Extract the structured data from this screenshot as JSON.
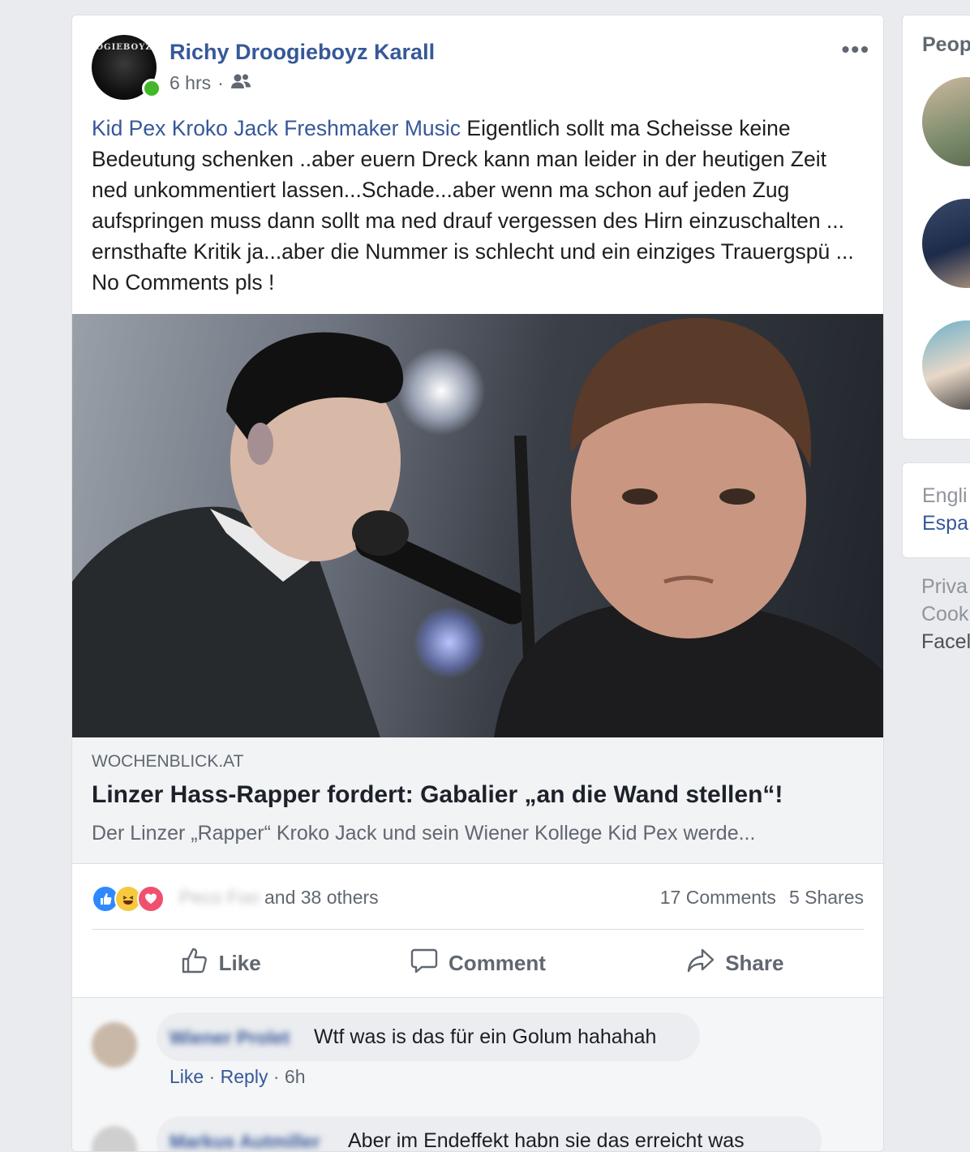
{
  "post": {
    "author": "Richy Droogieboyz Karall",
    "avatar_logo": "OGIEBOYZ",
    "time": "6 hrs",
    "separator": "·",
    "audience_icon": "friends-icon",
    "more_label": "•••",
    "mention": "Kid Pex Kroko Jack Freshmaker Music",
    "text": " Eigentlich sollt ma Scheisse keine Bedeutung schenken ..aber euern Dreck kann man leider in der heutigen Zeit ned unkommentiert lassen...Schade...aber wenn ma schon auf jeden Zug aufspringen muss dann sollt ma ned drauf vergessen des Hirn einzuschalten ... ernsthafte Kritik ja...aber die Nummer is schlecht und ein einziges Trauergspü ... No Comments pls !"
  },
  "link": {
    "domain": "WOCHENBLICK.AT",
    "title": "Linzer Hass-Rapper fordert: Gabalier „an die Wand stellen“!",
    "description": "Der Linzer „Rapper“ Kroko Jack und sein Wiener Kollege Kid Pex werde..."
  },
  "stats": {
    "reactions": [
      "like-icon",
      "haha-icon",
      "love-icon"
    ],
    "reactor_name": "Peco Foo",
    "others": "and 38 others",
    "comments": "17 Comments",
    "shares": "5 Shares"
  },
  "actions": {
    "like": "Like",
    "comment": "Comment",
    "share": "Share"
  },
  "comments": [
    {
      "name": "Wiener Prolet",
      "text": "Wtf was is das für ein Golum hahahah",
      "like": "Like",
      "reply": "Reply",
      "time": "6h"
    },
    {
      "name": "Markus Autmiller",
      "text": "Aber im Endeffekt habn sie das erreicht was"
    }
  ],
  "sidebar": {
    "people_title": "Peop",
    "lang_current": "Engli",
    "lang_other": "Espa",
    "footer": [
      "Priva",
      "Cook",
      "Facel"
    ]
  },
  "colors": {
    "link_blue": "#365899",
    "online_green": "#42b72a",
    "background": "#e9ebee"
  }
}
